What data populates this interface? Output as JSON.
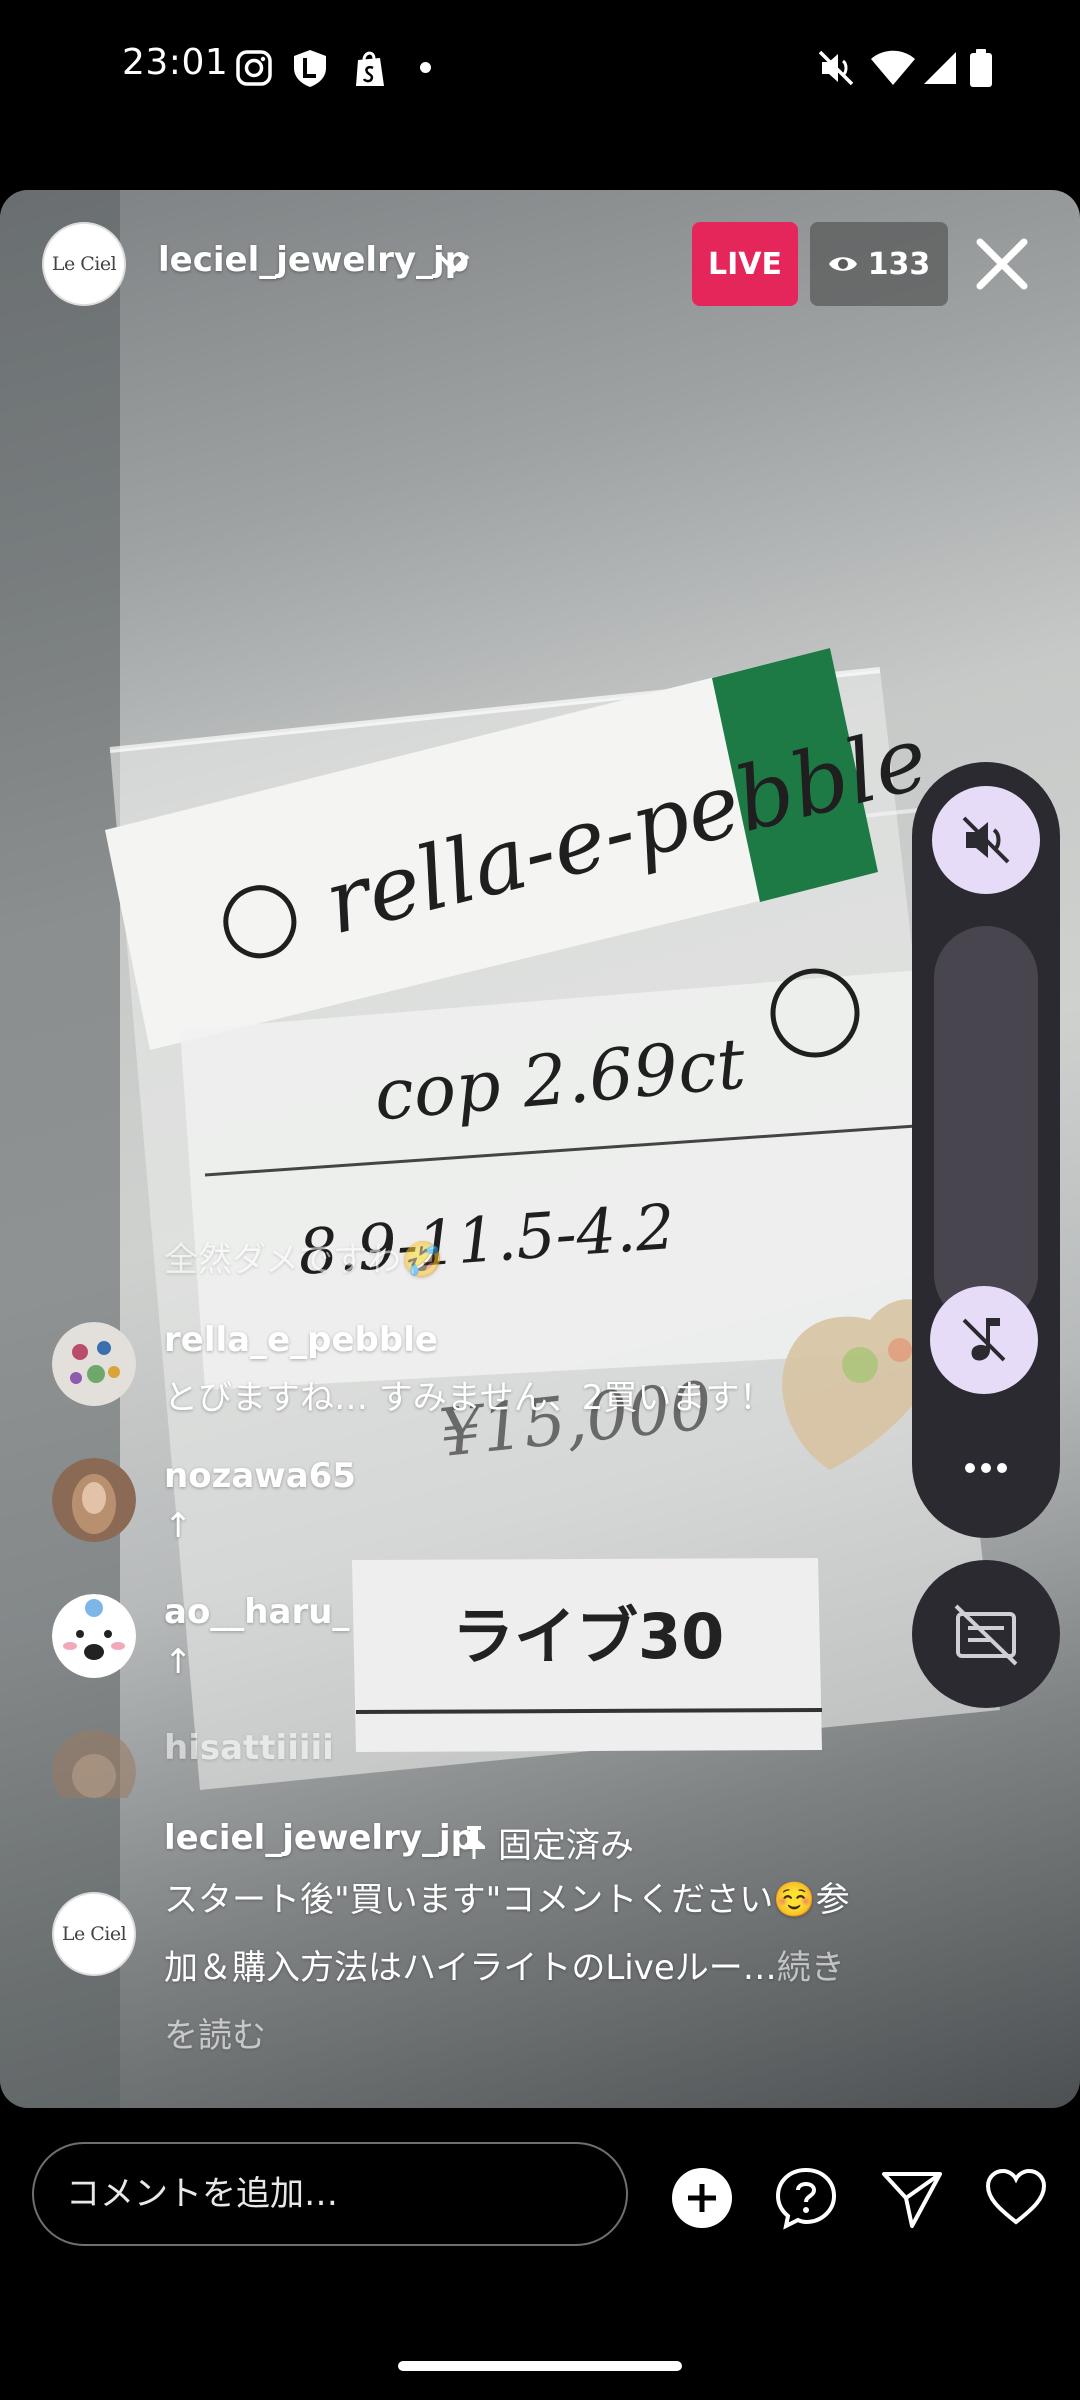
{
  "status_bar": {
    "time": "23:01",
    "left_icons": [
      "instagram-icon",
      "shield-l-icon",
      "shopify-bag-icon",
      "dot-icon"
    ],
    "right_icons": [
      "vibrate-off-icon",
      "wifi-icon",
      "signal-icon",
      "battery-icon"
    ]
  },
  "live": {
    "host_avatar_text": "Le Ciel",
    "host_username": "leciel_jewelry_jp",
    "live_badge": "LIVE",
    "viewer_count": "133"
  },
  "comments": [
    {
      "username": "",
      "text": "全然ダメですわ🤣",
      "faded": true
    },
    {
      "username": "rella_e_pebble",
      "text": "とびますね… すみません、2買います！"
    },
    {
      "username": "nozawa65",
      "text": "↑"
    },
    {
      "username": "ao__haru_",
      "text": "↑"
    },
    {
      "username": "hisattiiiii",
      "text": "",
      "faded": true
    }
  ],
  "pinned": {
    "username": "leciel_jewelry_jp",
    "pin_label": "固定済み",
    "line1": "スタート後\"買います\"コメントください☺️参",
    "line2": "加＆購入方法はハイライトのLiveルー…",
    "more_part1": "続き",
    "more_part2": "を読む"
  },
  "bottom_bar": {
    "comment_placeholder": "コメントを追加…",
    "icons": [
      "add-circle-icon",
      "question-bubble-icon",
      "send-icon",
      "heart-icon"
    ]
  },
  "volume_panel": {
    "icons": [
      "volume-mute-icon",
      "music-note-off-icon",
      "more-dots-icon",
      "captions-off-icon"
    ]
  },
  "colors": {
    "live_badge": "#e5265a",
    "panel": "#2c2a31",
    "panel_button": "#e6dcf7"
  }
}
